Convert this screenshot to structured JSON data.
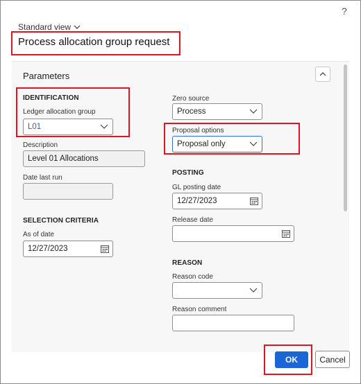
{
  "dialog": {
    "help_label": "?",
    "view_label": "Standard view",
    "title": "Process allocation group request"
  },
  "parameters": {
    "header": "Parameters",
    "identification": {
      "group_title": "IDENTIFICATION",
      "ledger_allocation_group_label": "Ledger allocation group",
      "ledger_allocation_group_value": "L01",
      "description_label": "Description",
      "description_value": "Level 01 Allocations",
      "date_last_run_label": "Date last run",
      "date_last_run_value": ""
    },
    "selection_criteria": {
      "group_title": "SELECTION CRITERIA",
      "as_of_date_label": "As of date",
      "as_of_date_value": "12/27/2023"
    },
    "zero_source": {
      "label": "Zero source",
      "value": "Process"
    },
    "proposal_options": {
      "label": "Proposal options",
      "value": "Proposal only"
    },
    "posting": {
      "group_title": "POSTING",
      "gl_posting_date_label": "GL posting date",
      "gl_posting_date_value": "12/27/2023",
      "release_date_label": "Release date",
      "release_date_value": ""
    },
    "reason": {
      "group_title": "REASON",
      "reason_code_label": "Reason code",
      "reason_code_value": "",
      "reason_comment_label": "Reason comment",
      "reason_comment_value": ""
    }
  },
  "footer": {
    "ok_label": "OK",
    "cancel_label": "Cancel"
  },
  "colors": {
    "highlight": "#e0141e",
    "primary_button": "#1a66d6",
    "link_text": "#2f5fb0"
  },
  "icons": [
    "chevron-down-icon",
    "chevron-up-icon",
    "calendar-icon",
    "help-icon"
  ]
}
